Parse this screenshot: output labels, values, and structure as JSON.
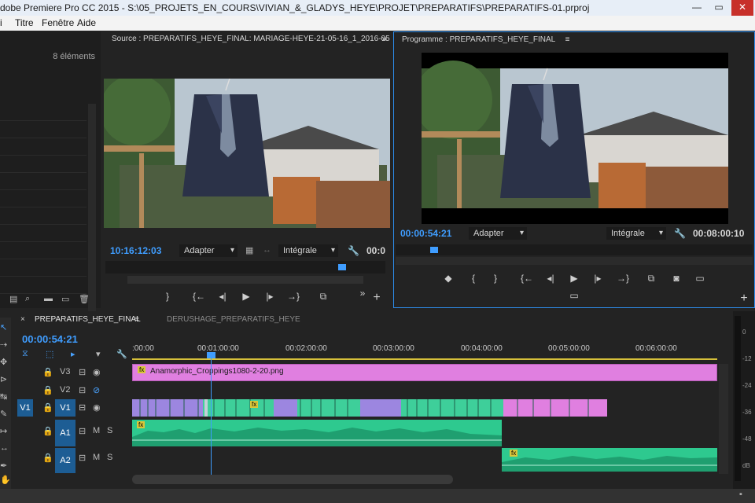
{
  "window": {
    "title": "dobe Premiere Pro CC 2015 - S:\\05_PROJETS_EN_COURS\\VIVIAN_&_GLADYS_HEYE\\PROJET\\PREPARATIFS\\PREPARATIFS-01.prproj",
    "minimize": "—",
    "restore": "▭",
    "close": "✕"
  },
  "menu": [
    "Titre",
    "Fenêtre",
    "Aide"
  ],
  "project_panel": {
    "item_count": "8 éléments"
  },
  "source_monitor": {
    "title": "Source : PREPARATIFS_HEYE_FINAL: MARIAGE-HEYE-21-05-16_1_2016-05",
    "timecode": "10:16:12:03",
    "fit": "Adapter",
    "resolution": "Intégrale",
    "duration": "00:0"
  },
  "program_monitor": {
    "title": "Programme : PREPARATIFS_HEYE_FINAL",
    "timecode": "00:00:54:21",
    "fit": "Adapter",
    "resolution": "Intégrale",
    "duration": "00:08:00:10"
  },
  "timeline": {
    "tabs": [
      "PREPARATIFS_HEYE_FINAL",
      "DERUSHAGE_PREPARATIFS_HEYE"
    ],
    "timecode": "00:00:54:21",
    "ruler": [
      ":00:00",
      "00:01:00:00",
      "00:02:00:00",
      "00:03:00:00",
      "00:04:00:00",
      "00:05:00:00",
      "00:06:00:00"
    ],
    "tracks": {
      "v3": "V3",
      "v2": "V2",
      "v1_src": "V1",
      "v1": "V1",
      "a1": "A1",
      "a2": "A2",
      "mute": "M",
      "solo": "S"
    },
    "title_clip": "Anamorphic_Croppings1080-2-20.png",
    "fx_badge": "fx"
  },
  "audio_meter": {
    "scale": [
      "0",
      "-12",
      "-24",
      "-36",
      "-48",
      "dB"
    ]
  },
  "colors": {
    "accent": "#2d8ceb",
    "timecode": "#3f9dff",
    "video_clip": "#9c86e0",
    "video_clip_alt": "#3ecf9a",
    "title_clip": "#e07fe0",
    "audio_clip": "#2ec98f"
  }
}
